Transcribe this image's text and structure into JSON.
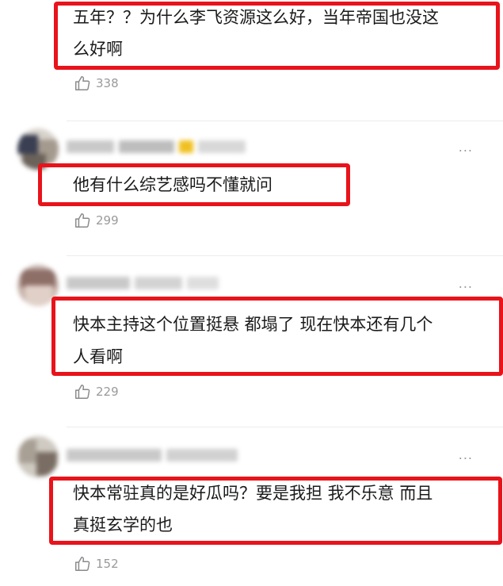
{
  "comments": [
    {
      "text_lines": [
        "五年？？为什么李飞资源这么好，当年帝国也没这",
        "么好啊"
      ],
      "likes": "338",
      "more_label": "..."
    },
    {
      "text_lines": [
        "他有什么综艺感吗不懂就问"
      ],
      "likes": "299",
      "more_label": "..."
    },
    {
      "text_lines": [
        "快本主持这个位置挺悬 都塌了 现在快本还有几个",
        "人看啊"
      ],
      "likes": "229",
      "more_label": "..."
    },
    {
      "text_lines": [
        "快本常驻真的是好瓜吗？要是我担 我不乐意 而且",
        "真挺玄学的也"
      ],
      "likes": "152",
      "more_label": "..."
    }
  ],
  "colors": {
    "highlight_border": "#e8131b",
    "meta_text": "#9a9a9a"
  },
  "icons": {
    "like": "thumbs-up-icon",
    "more": "more-dots-icon"
  }
}
